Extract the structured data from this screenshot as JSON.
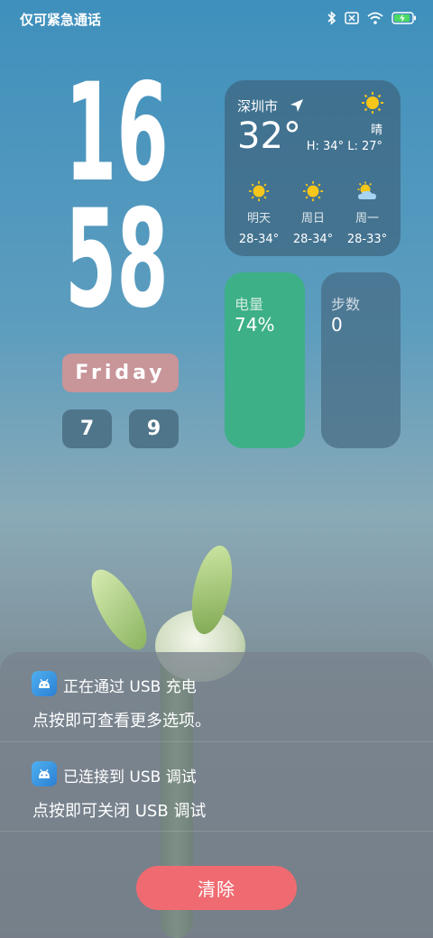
{
  "status_bar": {
    "carrier_text": "仅可紧急通话",
    "icons": [
      "bluetooth-icon",
      "no-sim-icon",
      "wifi-icon",
      "battery-charging-icon"
    ]
  },
  "clock": {
    "hour": "16",
    "minute": "58",
    "day": "Friday",
    "month": "7",
    "date": "9"
  },
  "weather": {
    "city": "深圳市",
    "temperature": "32°",
    "condition": "晴",
    "high_low": "H: 34°  L: 27°",
    "forecast": [
      {
        "label": "明天",
        "range": "28-34°",
        "icon": "sun-icon"
      },
      {
        "label": "周日",
        "range": "28-34°",
        "icon": "sun-icon"
      },
      {
        "label": "周一",
        "range": "28-33°",
        "icon": "partly-cloudy-icon"
      }
    ]
  },
  "battery": {
    "label": "电量",
    "value": "74%"
  },
  "steps": {
    "label": "步数",
    "value": "0"
  },
  "notifications": [
    {
      "title": "正在通过 USB 充电",
      "body": "点按即可查看更多选项。"
    },
    {
      "title": "已连接到 USB 调试",
      "body": "点按即可关闭 USB 调试"
    }
  ],
  "clear_button": "清除",
  "colors": {
    "accent_red": "#ef6b71",
    "battery_green": "#3db087",
    "day_pill": "#c89599"
  }
}
